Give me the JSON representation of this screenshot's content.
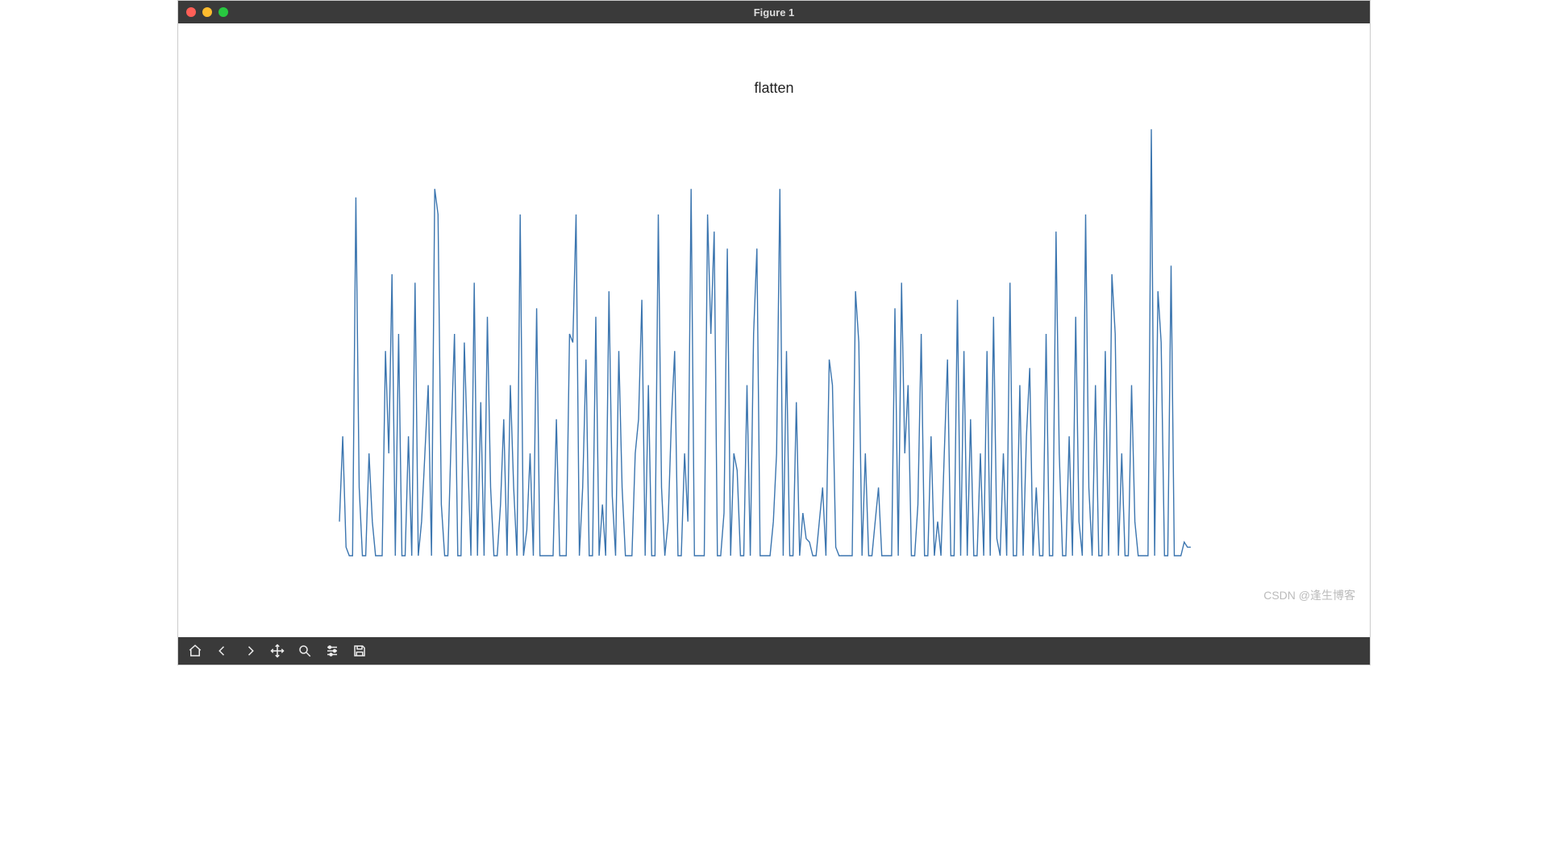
{
  "window": {
    "title": "Figure 1"
  },
  "toolbar": {
    "icons": [
      "home-icon",
      "back-icon",
      "forward-icon",
      "pan-icon",
      "zoom-icon",
      "configure-icon",
      "save-icon"
    ]
  },
  "watermark": "CSDN @逢生博客",
  "chart_data": {
    "type": "line",
    "title": "flatten",
    "xlabel": "",
    "ylabel": "",
    "xlim": [
      0,
      260
    ],
    "ylim": [
      0,
      260
    ],
    "grid": false,
    "x": [
      0,
      1,
      2,
      3,
      4,
      5,
      6,
      7,
      8,
      9,
      10,
      11,
      12,
      13,
      14,
      15,
      16,
      17,
      18,
      19,
      20,
      21,
      22,
      23,
      24,
      25,
      26,
      27,
      28,
      29,
      30,
      31,
      32,
      33,
      34,
      35,
      36,
      37,
      38,
      39,
      40,
      41,
      42,
      43,
      44,
      45,
      46,
      47,
      48,
      49,
      50,
      51,
      52,
      53,
      54,
      55,
      56,
      57,
      58,
      59,
      60,
      61,
      62,
      63,
      64,
      65,
      66,
      67,
      68,
      69,
      70,
      71,
      72,
      73,
      74,
      75,
      76,
      77,
      78,
      79,
      80,
      81,
      82,
      83,
      84,
      85,
      86,
      87,
      88,
      89,
      90,
      91,
      92,
      93,
      94,
      95,
      96,
      97,
      98,
      99,
      100,
      101,
      102,
      103,
      104,
      105,
      106,
      107,
      108,
      109,
      110,
      111,
      112,
      113,
      114,
      115,
      116,
      117,
      118,
      119,
      120,
      121,
      122,
      123,
      124,
      125,
      126,
      127,
      128,
      129,
      130,
      131,
      132,
      133,
      134,
      135,
      136,
      137,
      138,
      139,
      140,
      141,
      142,
      143,
      144,
      145,
      146,
      147,
      148,
      149,
      150,
      151,
      152,
      153,
      154,
      155,
      156,
      157,
      158,
      159,
      160,
      161,
      162,
      163,
      164,
      165,
      166,
      167,
      168,
      169,
      170,
      171,
      172,
      173,
      174,
      175,
      176,
      177,
      178,
      179,
      180,
      181,
      182,
      183,
      184,
      185,
      186,
      187,
      188,
      189,
      190,
      191,
      192,
      193,
      194,
      195,
      196,
      197,
      198,
      199,
      200,
      201,
      202,
      203,
      204,
      205,
      206,
      207,
      208,
      209,
      210,
      211,
      212,
      213,
      214,
      215,
      216,
      217,
      218,
      219,
      220,
      221,
      222,
      223,
      224,
      225,
      226,
      227,
      228,
      229,
      230,
      231,
      232,
      233,
      234,
      235,
      236,
      237,
      238,
      239,
      240,
      241,
      242,
      243,
      244,
      245,
      246,
      247,
      248,
      249,
      250,
      251,
      252,
      253,
      254,
      255,
      256,
      257,
      258,
      259
    ],
    "values": [
      20,
      70,
      5,
      0,
      0,
      210,
      40,
      0,
      0,
      60,
      20,
      0,
      0,
      0,
      120,
      60,
      165,
      0,
      130,
      0,
      0,
      70,
      0,
      160,
      0,
      20,
      60,
      100,
      0,
      215,
      200,
      30,
      0,
      0,
      70,
      130,
      0,
      0,
      125,
      60,
      0,
      160,
      0,
      90,
      0,
      140,
      40,
      0,
      0,
      30,
      80,
      0,
      100,
      40,
      0,
      200,
      0,
      15,
      60,
      0,
      145,
      0,
      0,
      0,
      0,
      0,
      80,
      0,
      0,
      0,
      130,
      125,
      200,
      0,
      40,
      115,
      0,
      0,
      140,
      0,
      30,
      0,
      155,
      35,
      0,
      120,
      40,
      0,
      0,
      0,
      60,
      80,
      150,
      0,
      100,
      0,
      0,
      200,
      40,
      0,
      20,
      80,
      120,
      0,
      0,
      60,
      20,
      215,
      0,
      0,
      0,
      0,
      200,
      130,
      190,
      0,
      0,
      25,
      180,
      0,
      60,
      50,
      0,
      0,
      100,
      0,
      130,
      180,
      0,
      0,
      0,
      0,
      20,
      60,
      215,
      0,
      120,
      0,
      0,
      90,
      0,
      25,
      10,
      8,
      0,
      0,
      20,
      40,
      0,
      115,
      100,
      5,
      0,
      0,
      0,
      0,
      0,
      155,
      125,
      0,
      60,
      0,
      0,
      20,
      40,
      0,
      0,
      0,
      0,
      145,
      0,
      160,
      60,
      100,
      0,
      0,
      30,
      130,
      0,
      0,
      70,
      0,
      20,
      0,
      60,
      115,
      0,
      0,
      150,
      0,
      120,
      0,
      80,
      0,
      0,
      60,
      0,
      120,
      0,
      140,
      10,
      0,
      60,
      0,
      160,
      0,
      0,
      100,
      0,
      70,
      110,
      0,
      40,
      0,
      0,
      130,
      0,
      0,
      190,
      60,
      0,
      0,
      70,
      0,
      140,
      20,
      0,
      200,
      40,
      0,
      100,
      0,
      0,
      120,
      0,
      165,
      130,
      0,
      60,
      0,
      0,
      100,
      20,
      0,
      0,
      0,
      0,
      250,
      0,
      155,
      125,
      0,
      0,
      170,
      0,
      0,
      0,
      8,
      5,
      5
    ],
    "color": "#3b75af"
  }
}
